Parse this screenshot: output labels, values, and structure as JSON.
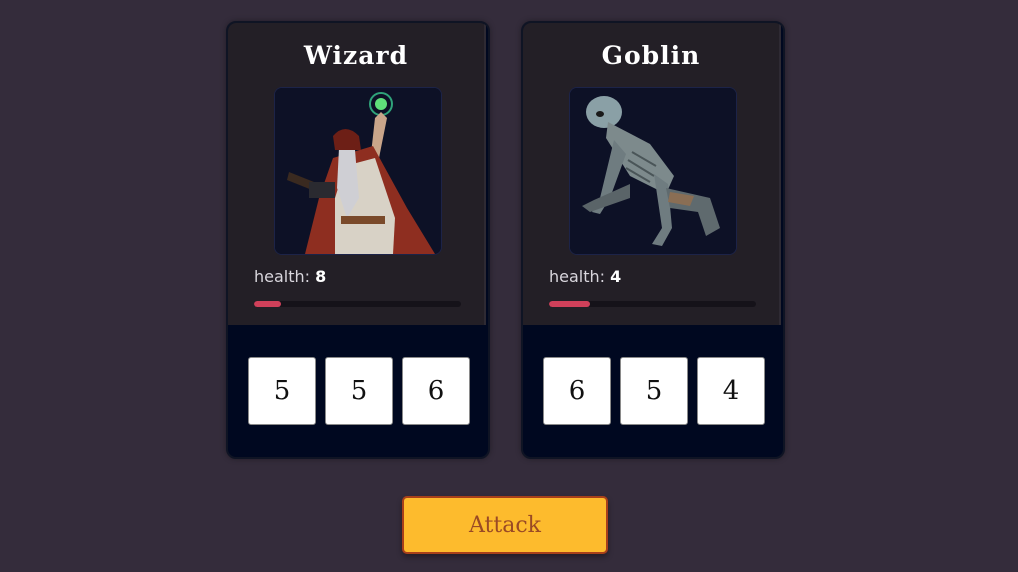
{
  "characters": [
    {
      "name": "Wizard",
      "health_label": "health:",
      "health": "8",
      "health_fraction": 0.13,
      "dice": [
        "5",
        "5",
        "6"
      ]
    },
    {
      "name": "Goblin",
      "health_label": "health:",
      "health": "4",
      "health_fraction": 0.2,
      "dice": [
        "6",
        "5",
        "4"
      ]
    }
  ],
  "attack_button": {
    "label": "Attack"
  },
  "colors": {
    "background": "#342c3b",
    "card_top": "#231f26",
    "card_bottom": "#000820",
    "health_fill": "#d0405a",
    "button": "#fdbb2d",
    "button_text": "#9a4a25"
  }
}
